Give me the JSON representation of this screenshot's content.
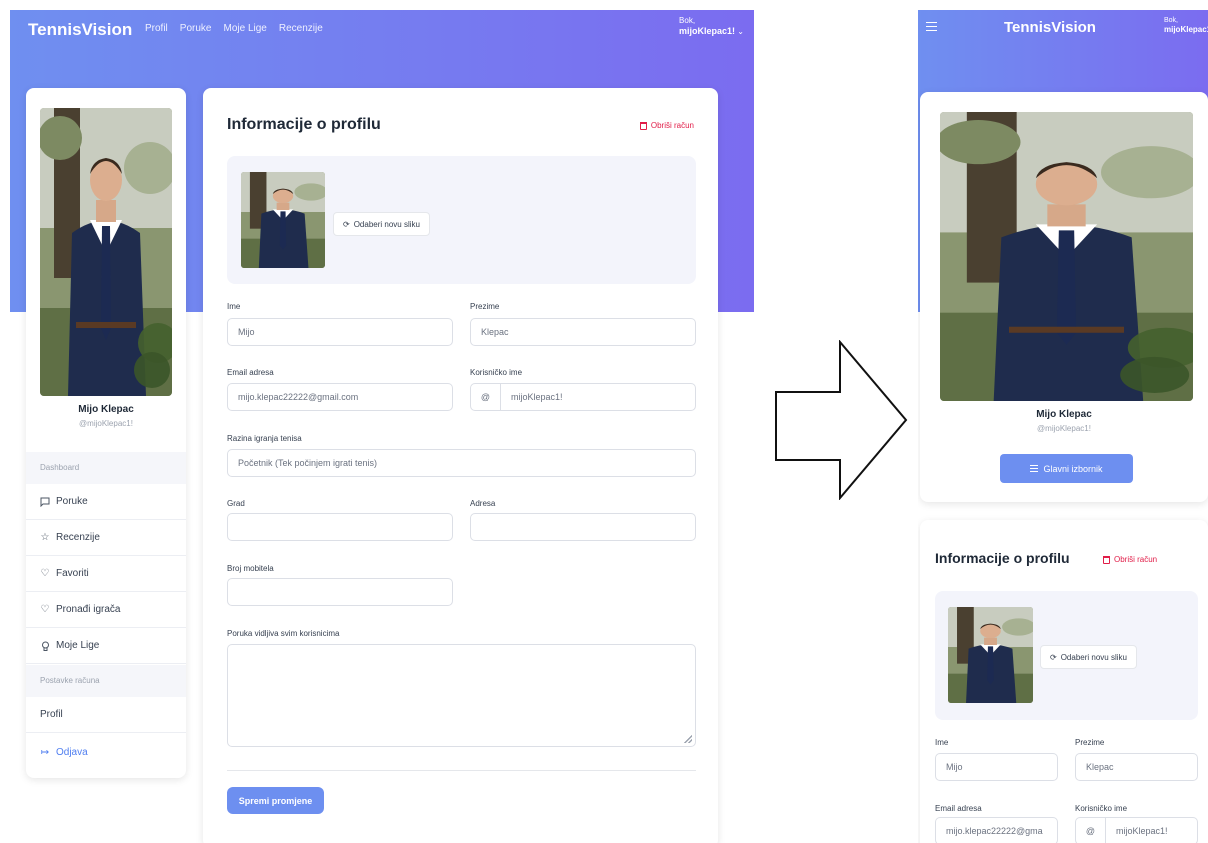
{
  "colors": {
    "accent": "#6d8ff0",
    "banner_start": "#6f8ff0",
    "banner_end": "#7b6cf0",
    "danger": "#e11d48"
  },
  "header": {
    "brand": "TennisVision",
    "nav": [
      "Profil",
      "Poruke",
      "Moje Lige",
      "Recenzije"
    ],
    "greeting": "Bok,",
    "username": "mijoKlepac1!"
  },
  "sidebar": {
    "name": "Mijo Klepac",
    "handle": "@mijoKlepac1!",
    "section_dashboard": "Dashboard",
    "items": [
      {
        "label": "Poruke",
        "icon": "message-icon"
      },
      {
        "label": "Recenzije",
        "icon": "star-icon"
      },
      {
        "label": "Favoriti",
        "icon": "heart-icon"
      },
      {
        "label": "Pronađi igrača",
        "icon": "heart-icon"
      },
      {
        "label": "Moje Lige",
        "icon": "trophy-icon"
      }
    ],
    "section_account": "Postavke računa",
    "profile_item": "Profil",
    "logout": "Odjava"
  },
  "profile_form": {
    "title": "Informacije o profilu",
    "delete_label": "Obriši račun",
    "change_photo": "Odaberi novu sliku",
    "first_name_label": "Ime",
    "first_name": "Mijo",
    "last_name_label": "Prezime",
    "last_name": "Klepac",
    "email_label": "Email adresa",
    "email": "mijo.klepac22222@gmail.com",
    "username_label": "Korisničko ime",
    "username_prefix": "@",
    "username": "mijoKlepac1!",
    "level_label": "Razina igranja tenisa",
    "level": "Početnik (Tek počinjem igrati tenis)",
    "city_label": "Grad",
    "city": "",
    "address_label": "Adresa",
    "address": "",
    "phone_label": "Broj mobitela",
    "phone": "",
    "message_label": "Poruka vidljiva svim korisnicima",
    "message": "",
    "save_label": "Spremi promjene"
  },
  "mobile": {
    "brand": "TennisVision",
    "greeting": "Bok,",
    "username_cut": "mijoKlepac1",
    "name": "Mijo Klepac",
    "handle": "@mijoKlepac1!",
    "main_menu": "Glavni izbornik",
    "email_visible": "mijo.klepac22222@gma"
  }
}
